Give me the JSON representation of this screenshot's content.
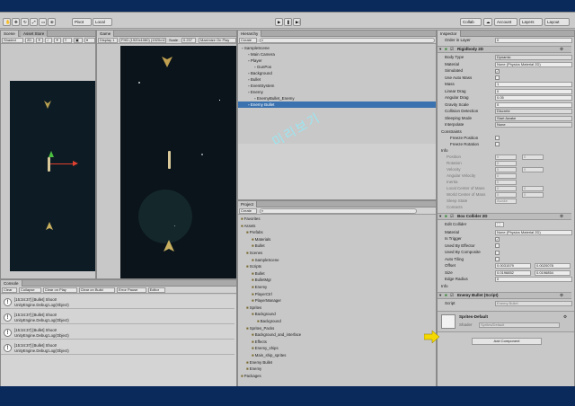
{
  "toolbar": {
    "items": [
      "Pivot",
      "Local",
      "Collab",
      "Account",
      "Layers",
      "Layout"
    ]
  },
  "scene": {
    "tab": "Scene",
    "tab2": "Asset Store",
    "shading": "Shaded",
    "mode": "2D"
  },
  "game": {
    "tab": "Game",
    "display": "Display 1",
    "resolution": "FHD (1920x1080) (1920x1080)",
    "scale_label": "Scale",
    "scale": "0.237",
    "max_label": "Maximize On Play"
  },
  "hierarchy": {
    "tab": "Hierarchy",
    "create": "Create",
    "rows": [
      {
        "text": "SampleScene",
        "indent": 0,
        "selected": false
      },
      {
        "text": "Main Camera",
        "indent": 1,
        "selected": false
      },
      {
        "text": "Player",
        "indent": 1,
        "selected": false
      },
      {
        "text": "GunPos",
        "indent": 2,
        "selected": false
      },
      {
        "text": "Background",
        "indent": 1,
        "selected": false
      },
      {
        "text": "Bullet",
        "indent": 1,
        "selected": false
      },
      {
        "text": "EventSystem",
        "indent": 1,
        "selected": false
      },
      {
        "text": "Enemy",
        "indent": 1,
        "selected": false
      },
      {
        "text": "EnemyBullet_Enemy",
        "indent": 2,
        "selected": false
      },
      {
        "text": "Enemy Bullet",
        "indent": 1,
        "selected": true
      }
    ]
  },
  "watermark": "미리보기",
  "project": {
    "tab": "Project",
    "create": "Create",
    "rows": [
      {
        "text": "Favorites",
        "indent": 0
      },
      {
        "text": "Assets",
        "indent": 0
      },
      {
        "text": "Prefabs",
        "indent": 1
      },
      {
        "text": "Materials",
        "indent": 2
      },
      {
        "text": "Bullet",
        "indent": 2
      },
      {
        "text": "Scenes",
        "indent": 1
      },
      {
        "text": "SampleScene",
        "indent": 2
      },
      {
        "text": "Scripts",
        "indent": 1
      },
      {
        "text": "Bullet",
        "indent": 2
      },
      {
        "text": "BulletMgr",
        "indent": 2
      },
      {
        "text": "Enemy",
        "indent": 2
      },
      {
        "text": "PlayerCtrl",
        "indent": 2
      },
      {
        "text": "PlayerManager",
        "indent": 2
      },
      {
        "text": "Sprites",
        "indent": 1
      },
      {
        "text": "Background",
        "indent": 2
      },
      {
        "text": "Background",
        "indent": 3
      },
      {
        "text": "Sprites_Packs",
        "indent": 1
      },
      {
        "text": "Background_and_interface",
        "indent": 2
      },
      {
        "text": "Effects",
        "indent": 2
      },
      {
        "text": "Enemy_ships",
        "indent": 2
      },
      {
        "text": "Main_ship_sprites",
        "indent": 2
      },
      {
        "text": "Enemy Bullet",
        "indent": 1
      },
      {
        "text": "Enemy",
        "indent": 1
      },
      {
        "text": "Packages",
        "indent": 0
      }
    ]
  },
  "console": {
    "tab": "Console",
    "buttons": [
      "Clear",
      "Collapse",
      "Clear on Play",
      "Clear on Build",
      "Error Pause",
      "Editor"
    ],
    "entries": [
      {
        "line1": "[15:34:37] [Bullet] Shoot!",
        "line2": "UnityEngine.Debug:Log(Object)"
      },
      {
        "line1": "[15:34:37] [Bullet] Shoot!",
        "line2": "UnityEngine.Debug:Log(Object)"
      },
      {
        "line1": "[15:34:37] [Bullet] Shoot!",
        "line2": "UnityEngine.Debug:Log(Object)"
      },
      {
        "line1": "[15:34:37] [Bullet] Shoot!",
        "line2": "UnityEngine.Debug:Log(Object)"
      }
    ]
  },
  "inspector": {
    "tab": "Inspector",
    "layer_label": "Order in Layer",
    "layer_value": "0",
    "rigidbody": {
      "title": "Rigidbody 2D",
      "props": [
        {
          "label": "Body Type",
          "value": "Dynamic",
          "kind": "dropdown"
        },
        {
          "label": "Material",
          "value": "None (Physics Material 2D)",
          "kind": "field"
        },
        {
          "label": "Simulated",
          "value": "✓",
          "kind": "check"
        },
        {
          "label": "Use Auto Mass",
          "value": "",
          "kind": "check"
        },
        {
          "label": "Mass",
          "value": "1",
          "kind": "field"
        },
        {
          "label": "Linear Drag",
          "value": "0",
          "kind": "field"
        },
        {
          "label": "Angular Drag",
          "value": "0.05",
          "kind": "field"
        },
        {
          "label": "Gravity Scale",
          "value": "0",
          "kind": "field"
        },
        {
          "label": "Collision Detection",
          "value": "Discrete",
          "kind": "dropdown"
        },
        {
          "label": "Sleeping Mode",
          "value": "Start Awake",
          "kind": "dropdown"
        },
        {
          "label": "Interpolate",
          "value": "None",
          "kind": "dropdown"
        }
      ],
      "constraints": "Constraints",
      "freeze_pos": "Freeze Position",
      "freeze_rot": "Freeze Rotation",
      "info": "Info",
      "info_props": [
        {
          "label": "Position",
          "x": "0",
          "y": "0"
        },
        {
          "label": "Rotation",
          "x": "0",
          "y": ""
        },
        {
          "label": "Velocity",
          "x": "0",
          "y": "0"
        },
        {
          "label": "Angular Velocity",
          "x": "0",
          "y": ""
        },
        {
          "label": "Inertia",
          "x": "0",
          "y": ""
        },
        {
          "label": "Local Center of Mass",
          "x": "0",
          "y": "0"
        },
        {
          "label": "World Center of Mass",
          "x": "0",
          "y": "0"
        },
        {
          "label": "Sleep State",
          "x": "Awake",
          "y": ""
        },
        {
          "label": "Contacts",
          "x": "",
          "y": ""
        }
      ]
    },
    "boxcollider": {
      "title": "Box Collider 2D",
      "edit_label": "Edit Collider",
      "props": [
        {
          "label": "Material",
          "value": "None (Physics Material 2D)",
          "kind": "field"
        },
        {
          "label": "Is Trigger",
          "value": "✓",
          "kind": "check"
        },
        {
          "label": "Used By Effector",
          "value": "",
          "kind": "check"
        },
        {
          "label": "Used By Composite",
          "value": "",
          "kind": "check"
        },
        {
          "label": "Auto Tiling",
          "value": "",
          "kind": "check"
        }
      ],
      "offset_label": "Offset",
      "offset_x": "0.0031579",
      "offset_y": "0.0020078",
      "size_label": "Size",
      "size_x": "0.0196852",
      "size_y": "0.0196854",
      "edge_label": "Edge Radius",
      "edge_value": "0",
      "info": "Info"
    },
    "script": {
      "title": "Enemy Bullet (Script)",
      "script_label": "Script",
      "script_value": "Enemy Bullet"
    },
    "material": {
      "title": "Sprites-Default",
      "shader_label": "Shader",
      "shader_value": "Sprites/Default"
    },
    "add_component": "Add Component"
  },
  "colors": {
    "selected": "#3a72b0",
    "arrow": "#f5d800",
    "space": "#0a141a"
  }
}
